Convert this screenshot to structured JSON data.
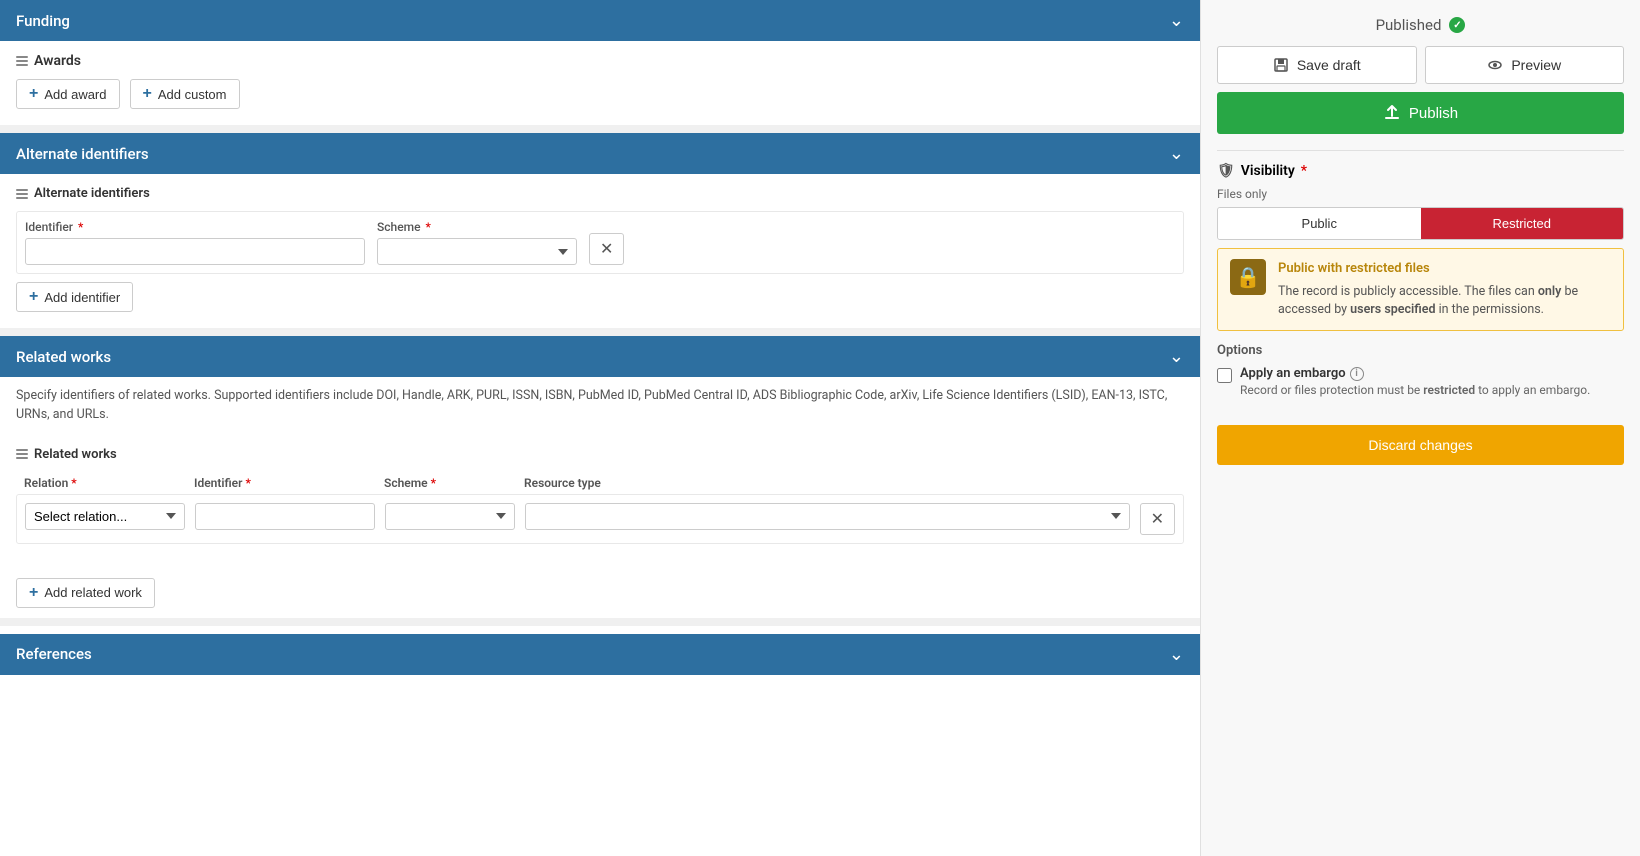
{
  "leftPanel": {
    "funding": {
      "title": "Funding"
    },
    "awards": {
      "sectionTitle": "Awards",
      "addAwardBtn": "Add award",
      "addCustomBtn": "Add custom"
    },
    "alternateIdentifiers": {
      "headerTitle": "Alternate identifiers",
      "subsectionTitle": "Alternate identifiers",
      "identifier": {
        "label": "Identifier",
        "required": true,
        "placeholder": ""
      },
      "scheme": {
        "label": "Scheme",
        "required": true,
        "placeholder": ""
      },
      "addIdentifierBtn": "Add identifier"
    },
    "relatedWorks": {
      "headerTitle": "Related works",
      "description": "Specify identifiers of related works. Supported identifiers include DOI, Handle, ARK, PURL, ISSN, ISBN, PubMed ID, PubMed Central ID, ADS Bibliographic Code, arXiv, Life Science Identifiers (LSID), EAN-13, ISTC, URNs, and URLs.",
      "subsectionTitle": "Related works",
      "relation": {
        "label": "Relation",
        "required": true,
        "placeholder": "Select relation..."
      },
      "identifier": {
        "label": "Identifier",
        "required": true
      },
      "scheme": {
        "label": "Scheme",
        "required": true
      },
      "resourceType": {
        "label": "Resource type"
      },
      "addRelatedWorkBtn": "Add related work"
    },
    "references": {
      "headerTitle": "References"
    }
  },
  "rightPanel": {
    "publishedStatus": "Published",
    "saveDraftBtn": "Save draft",
    "previewBtn": "Preview",
    "publishBtn": "Publish",
    "visibility": {
      "title": "Visibility",
      "required": true,
      "filesOnlyLabel": "Files only",
      "publicBtn": "Public",
      "restrictedBtn": "Restricted",
      "notice": {
        "title": "Public with restricted files",
        "line1": "The record is publicly accessible. The files can",
        "only": "only",
        "line2": "be accessed by",
        "usersSpecified": "users specified",
        "line3": "in the permissions."
      }
    },
    "options": {
      "title": "Options",
      "embargo": {
        "label": "Apply an embargo",
        "description": "Record or files protection must be",
        "restricted": "restricted",
        "description2": "to apply an embargo."
      }
    },
    "discardBtn": "Discard changes"
  }
}
